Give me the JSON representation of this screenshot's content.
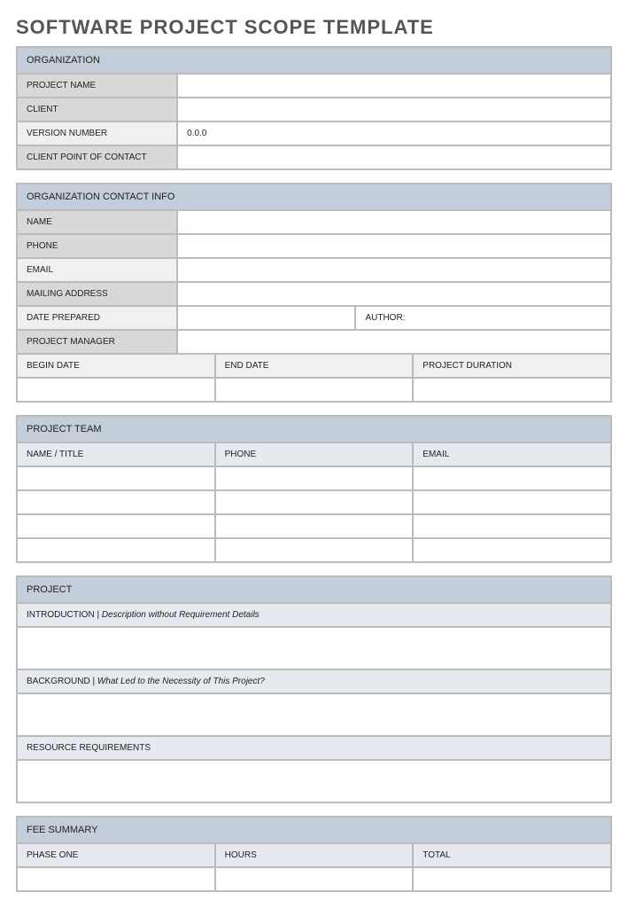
{
  "title": "SOFTWARE PROJECT SCOPE TEMPLATE",
  "organization": {
    "header": "ORGANIZATION",
    "projectNameLabel": "PROJECT NAME",
    "projectNameValue": "",
    "clientLabel": "CLIENT",
    "clientValue": "",
    "versionNumberLabel": "VERSION NUMBER",
    "versionNumberValue": "0.0.0",
    "clientPointOfContactLabel": "CLIENT POINT OF CONTACT",
    "clientPointOfContactValue": ""
  },
  "contactInfo": {
    "header": "ORGANIZATION CONTACT INFO",
    "nameLabel": "NAME",
    "nameValue": "",
    "phoneLabel": "PHONE",
    "phoneValue": "",
    "emailLabel": "EMAIL",
    "emailValue": "",
    "mailingAddressLabel": "MAILING ADDRESS",
    "mailingAddressValue": "",
    "datePreparedLabel": "DATE PREPARED",
    "datePreparedValue": "",
    "authorLabel": "AUTHOR:",
    "authorValue": "",
    "projectManagerLabel": "PROJECT MANAGER",
    "projectManagerValue": "",
    "beginDateLabel": "BEGIN DATE",
    "endDateLabel": "END DATE",
    "projectDurationLabel": "PROJECT DURATION",
    "beginDateValue": "",
    "endDateValue": "",
    "projectDurationValue": ""
  },
  "projectTeam": {
    "header": "PROJECT TEAM",
    "nameTitleLabel": "NAME / TITLE",
    "phoneLabel": "PHONE",
    "emailLabel": "EMAIL",
    "rows": [
      {
        "name": "",
        "phone": "",
        "email": ""
      },
      {
        "name": "",
        "phone": "",
        "email": ""
      },
      {
        "name": "",
        "phone": "",
        "email": ""
      },
      {
        "name": "",
        "phone": "",
        "email": ""
      }
    ]
  },
  "project": {
    "header": "PROJECT",
    "introductionLabel": "INTRODUCTION |",
    "introductionDesc": " Description without Requirement Details",
    "introductionValue": "",
    "backgroundLabel": "BACKGROUND |",
    "backgroundDesc": " What Led to the Necessity of This Project?",
    "backgroundValue": "",
    "resourceRequirementsLabel": "RESOURCE REQUIREMENTS",
    "resourceRequirementsValue": ""
  },
  "feeSummary": {
    "header": "FEE SUMMARY",
    "phaseOneLabel": "PHASE ONE",
    "hoursLabel": "HOURS",
    "totalLabel": "TOTAL",
    "rows": [
      {
        "phase": "",
        "hours": "",
        "total": ""
      }
    ]
  }
}
